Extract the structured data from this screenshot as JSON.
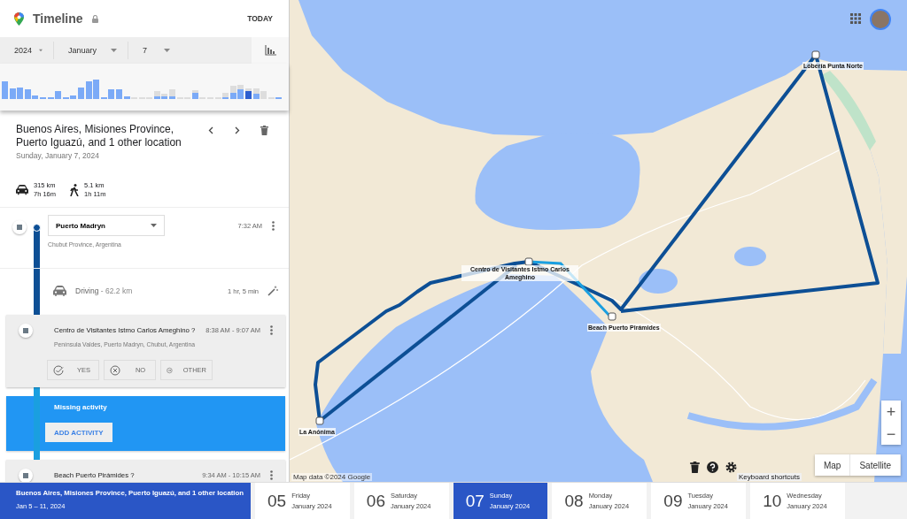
{
  "header": {
    "title": "Timeline",
    "today_button": "TODAY"
  },
  "date_selectors": [
    {
      "value": "2024"
    },
    {
      "value": "January"
    },
    {
      "value": "7"
    }
  ],
  "day_summary": {
    "title": "Buenos Aires, Misiones Province, Puerto Iguazú, and 1 other location",
    "date": "Sunday, January 7, 2024",
    "stats": [
      {
        "kind": "car",
        "distance": "315 km",
        "duration": "7h 16m"
      },
      {
        "kind": "walk",
        "distance": "5.1 km",
        "duration": "1h 11m"
      }
    ]
  },
  "timeline": [
    {
      "kind": "place",
      "name": "Puerto Madryn",
      "address": "Chubut Province, Argentina",
      "time": "7:32 AM"
    },
    {
      "kind": "activity",
      "activity": "**Driving** - 62.2 km",
      "duration": "1 hr, 5 min"
    },
    {
      "kind": "visit",
      "name": "Centro de Visitantes Istmo Carlos Ameghino ?",
      "address": "Península Valdes, Puerto Madryn, Chubut, Argentina",
      "time": "8:38 AM - 9:07 AM",
      "actions": [
        {
          "kind": "yes",
          "label": "YES"
        },
        {
          "kind": "no",
          "label": "NO"
        },
        {
          "kind": "other",
          "label": "OTHER"
        }
      ]
    },
    {
      "kind": "missing",
      "title": "Missing activity",
      "button": "ADD ACTIVITY"
    },
    {
      "kind": "visit",
      "name": "Beach Puerto Pirámides ?",
      "time": "9:34 AM - 10:15 AM"
    }
  ],
  "map": {
    "markers": [
      {
        "label": "Lobería Punta Norte"
      },
      {
        "label": "Centro de Visitantes Istmo Carlos Ameghino"
      },
      {
        "label": "Beach Puerto Pirámides"
      },
      {
        "label": "La Anónima"
      }
    ],
    "zoom_in": "+",
    "zoom_out": "−",
    "map_types": [
      "Map",
      "Satellite"
    ],
    "attribution": "Map data ©2024 Google",
    "keyboard_shortcuts": "Keyboard shortcuts"
  },
  "trip_bar": {
    "title": "Buenos Aires, Misiones Province, Puerto Iguazú, and 1 other location",
    "dates": "Jan 5 – 11, 2024",
    "days": [
      {
        "day": "05",
        "weekday": "Friday",
        "month": "January 2024",
        "selected": false
      },
      {
        "day": "06",
        "weekday": "Saturday",
        "month": "January 2024",
        "selected": false
      },
      {
        "day": "07",
        "weekday": "Sunday",
        "month": "January 2024",
        "selected": true
      },
      {
        "day": "08",
        "weekday": "Monday",
        "month": "January 2024",
        "selected": false
      },
      {
        "day": "09",
        "weekday": "Tuesday",
        "month": "January 2024",
        "selected": false
      },
      {
        "day": "10",
        "weekday": "Wednesday",
        "month": "January 2024",
        "selected": false
      }
    ]
  }
}
